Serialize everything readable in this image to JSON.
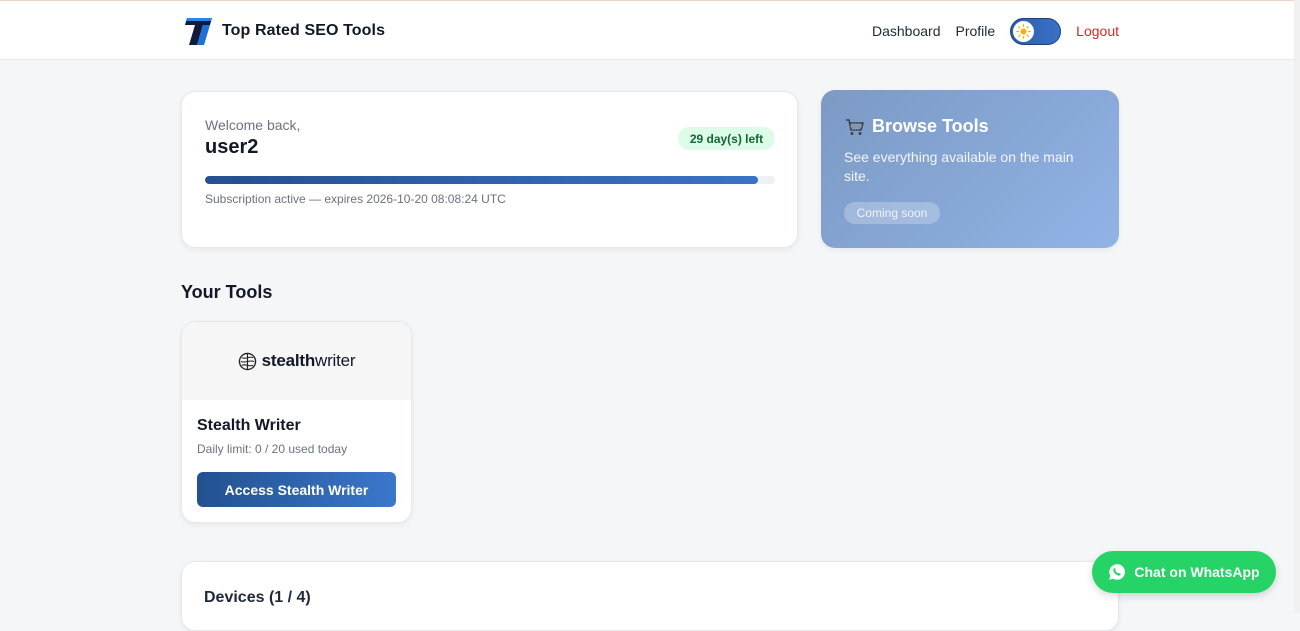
{
  "header": {
    "brand_name": "Top Rated SEO Tools",
    "logo_icon": "brand-t-logo",
    "nav": {
      "dashboard": "Dashboard",
      "profile": "Profile",
      "logout": "Logout"
    },
    "theme_toggle": {
      "icon": "sun-icon",
      "state": "light"
    }
  },
  "welcome": {
    "label": "Welcome back,",
    "username": "user2",
    "days_left": "29 day(s) left",
    "progress_fraction": 0.97,
    "subscription_text": "Subscription active — expires 2026-10-20 08:08:24 UTC"
  },
  "browse": {
    "icon": "cart-icon",
    "title": "Browse Tools",
    "description": "See everything available on the main site.",
    "badge": "Coming soon"
  },
  "tools": {
    "section_title": "Your Tools",
    "items": [
      {
        "logo_bold": "stealth",
        "logo_light": "writer",
        "name": "Stealth Writer",
        "limit": "Daily limit: 0 / 20 used today",
        "button": "Access Stealth Writer"
      }
    ]
  },
  "devices": {
    "title": "Devices (1 / 4)"
  },
  "whatsapp": {
    "label": "Chat on WhatsApp",
    "icon": "whatsapp-icon"
  },
  "colors": {
    "accent": "#2b5ca9",
    "logout": "#dc2626",
    "badge_bg": "#dcfce7",
    "badge_text": "#166534",
    "whatsapp": "#25d366"
  }
}
